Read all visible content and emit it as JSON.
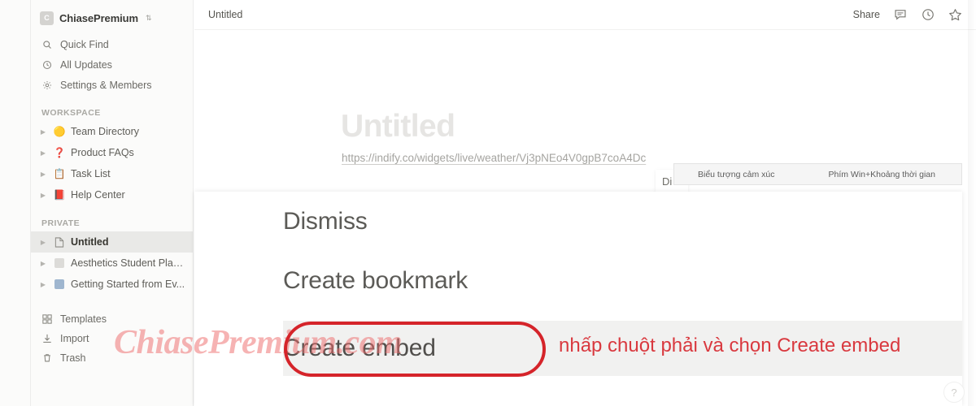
{
  "sidebar": {
    "workspace_name": "ChiasePremium",
    "workspace_logo_letter": "C",
    "workspace_caret_icon": "chevron-updown-icon",
    "nav": [
      {
        "label": "Quick Find",
        "icon": "search-icon"
      },
      {
        "label": "All Updates",
        "icon": "clock-icon"
      },
      {
        "label": "Settings & Members",
        "icon": "gear-icon"
      }
    ],
    "workspace_section_label": "WORKSPACE",
    "workspace_items": [
      {
        "label": "Team Directory",
        "emoji": "🟡",
        "icon": "yellow-circle-emoji",
        "toggle_icon": "triangle-right-icon"
      },
      {
        "label": "Product FAQs",
        "emoji": "❓",
        "icon": "question-mark-emoji",
        "toggle_icon": "triangle-right-icon"
      },
      {
        "label": "Task List",
        "emoji": "📋",
        "icon": "clipboard-emoji",
        "toggle_icon": "triangle-right-icon"
      },
      {
        "label": "Help Center",
        "emoji": "📕",
        "icon": "book-emoji",
        "toggle_icon": "triangle-right-icon"
      }
    ],
    "private_section_label": "PRIVATE",
    "private_items": [
      {
        "label": "Untitled",
        "icon": "page-icon",
        "toggle_icon": "triangle-right-icon",
        "selected": true
      },
      {
        "label": "Aesthetics Student Plan...",
        "icon": "note-icon",
        "toggle_icon": "triangle-right-icon",
        "selected": false
      },
      {
        "label": "Getting Started from Ev...",
        "icon": "evernote-icon",
        "toggle_icon": "triangle-right-icon",
        "selected": false
      }
    ],
    "bottom_items": [
      {
        "label": "Templates",
        "icon": "templates-icon"
      },
      {
        "label": "Import",
        "icon": "import-icon"
      },
      {
        "label": "Trash",
        "icon": "trash-icon"
      }
    ]
  },
  "topbar": {
    "tab_title": "Untitled",
    "share_label": "Share",
    "comment_icon": "comment-icon",
    "updates_icon": "clock-icon",
    "favorite_icon": "star-icon"
  },
  "document": {
    "title": "Untitled",
    "link_url": "https://indify.co/widgets/live/weather/Vj3pNEo4V0gpB7coA4Dc"
  },
  "win_tooltip": {
    "left_text": "Biểu tượng cảm xúc",
    "right_text": "Phím Win+Khoảng thời gian"
  },
  "peek_row": {
    "text": "Di"
  },
  "context_menu": {
    "items": [
      {
        "label": "Dismiss",
        "highlighted": false
      },
      {
        "label": "Create bookmark",
        "highlighted": false
      },
      {
        "label": "Create embed",
        "highlighted": true
      }
    ]
  },
  "annotation": {
    "text": "nhấp chuột phải và chọn Create embed",
    "color": "#d9393f",
    "highlight_box_color": "#d5242a"
  },
  "watermark": {
    "text": "ChiasePremium.com",
    "color": "#ee6e6e"
  },
  "help": {
    "label": "?"
  }
}
